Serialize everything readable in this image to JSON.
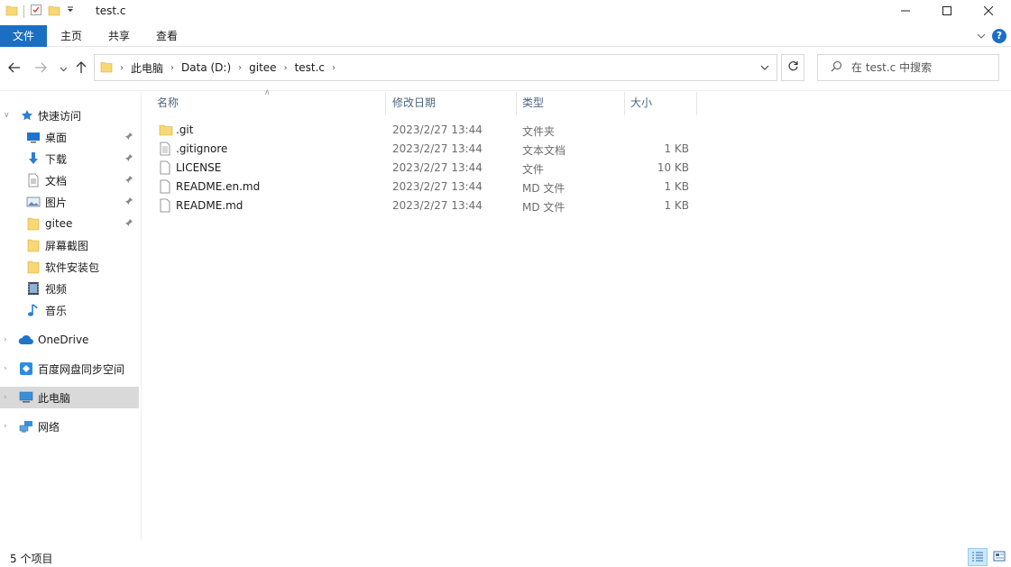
{
  "window": {
    "title": "test.c"
  },
  "ribbon": {
    "tabs": [
      {
        "label": "文件"
      },
      {
        "label": "主页"
      },
      {
        "label": "共享"
      },
      {
        "label": "查看"
      }
    ],
    "help_label": "?"
  },
  "address": {
    "crumbs": [
      "此电脑",
      "Data (D:)",
      "gitee",
      "test.c"
    ]
  },
  "search": {
    "placeholder": "在 test.c 中搜索"
  },
  "sidebar": {
    "quick_access": {
      "label": "快速访问"
    },
    "items": [
      {
        "label": "桌面",
        "icon": "desktop-icon",
        "pinned": true
      },
      {
        "label": "下载",
        "icon": "download-icon",
        "pinned": true
      },
      {
        "label": "文档",
        "icon": "documents-icon",
        "pinned": true
      },
      {
        "label": "图片",
        "icon": "pictures-icon",
        "pinned": true
      },
      {
        "label": "gitee",
        "icon": "folder-icon",
        "pinned": true
      },
      {
        "label": "屏幕截图",
        "icon": "folder-icon",
        "pinned": false
      },
      {
        "label": "软件安装包",
        "icon": "folder-icon",
        "pinned": false
      },
      {
        "label": "视频",
        "icon": "video-icon",
        "pinned": false
      },
      {
        "label": "音乐",
        "icon": "music-icon",
        "pinned": false
      }
    ],
    "onedrive": {
      "label": "OneDrive"
    },
    "baidu": {
      "label": "百度网盘同步空间"
    },
    "thispc": {
      "label": "此电脑"
    },
    "network": {
      "label": "网络"
    }
  },
  "columns": {
    "name": "名称",
    "date": "修改日期",
    "type": "类型",
    "size": "大小"
  },
  "files": [
    {
      "name": ".git",
      "date": "2023/2/27 13:44",
      "type": "文件夹",
      "size": "",
      "icon": "folder-icon"
    },
    {
      "name": ".gitignore",
      "date": "2023/2/27 13:44",
      "type": "文本文档",
      "size": "1 KB",
      "icon": "text-file-icon"
    },
    {
      "name": "LICENSE",
      "date": "2023/2/27 13:44",
      "type": "文件",
      "size": "10 KB",
      "icon": "file-icon"
    },
    {
      "name": "README.en.md",
      "date": "2023/2/27 13:44",
      "type": "MD 文件",
      "size": "1 KB",
      "icon": "file-icon"
    },
    {
      "name": "README.md",
      "date": "2023/2/27 13:44",
      "type": "MD 文件",
      "size": "1 KB",
      "icon": "file-icon"
    }
  ],
  "status": {
    "item_count": "5 个项目"
  },
  "colors": {
    "accent": "#1a6fc4",
    "folder": "#f8d775",
    "selected": "#d9d9d9"
  }
}
